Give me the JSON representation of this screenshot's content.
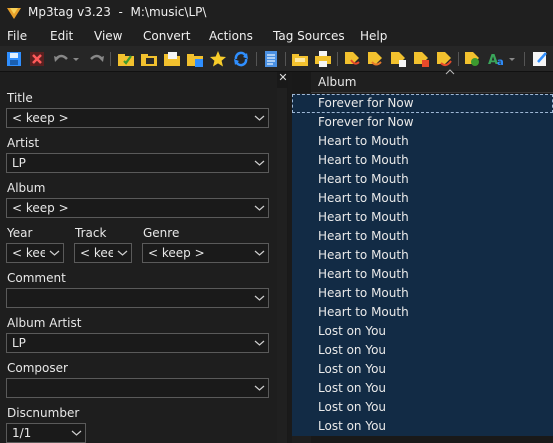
{
  "window": {
    "title": "Mp3tag v3.23  -  M:\\music\\LP\\"
  },
  "menu": [
    "File",
    "Edit",
    "View",
    "Convert",
    "Actions",
    "Tag Sources",
    "Help"
  ],
  "toolbar": {
    "buttons": [
      "save-icon",
      "remove-icon",
      "undo-icon",
      "redo-icon",
      "folder-check-icon",
      "folder-add-icon",
      "folder-open-icon",
      "folder-tag-icon",
      "star-icon",
      "refresh-icon",
      "text-file-icon",
      "folder-export-icon",
      "print-icon",
      "tag-convert-1-icon",
      "tag-convert-2-icon",
      "tag-convert-3-icon",
      "tag-convert-4-icon",
      "tag-convert-5-icon",
      "tag-sources-icon",
      "text-case-icon",
      "edit-note-icon"
    ],
    "accent_blue": "#2f8fff",
    "folder_yellow": "#f2c12e"
  },
  "panel": {
    "close_glyph": "✕"
  },
  "fields": {
    "title": {
      "label": "Title",
      "value": "< keep >"
    },
    "artist": {
      "label": "Artist",
      "value": "LP"
    },
    "album": {
      "label": "Album",
      "value": "< keep >"
    },
    "year": {
      "label": "Year",
      "value": "< keep >"
    },
    "track": {
      "label": "Track",
      "value": "< keep >"
    },
    "genre": {
      "label": "Genre",
      "value": "< keep >"
    },
    "comment": {
      "label": "Comment",
      "value": ""
    },
    "album_artist": {
      "label": "Album Artist",
      "value": "LP"
    },
    "composer": {
      "label": "Composer",
      "value": ""
    },
    "discnumber": {
      "label": "Discnumber",
      "value": "1/1"
    }
  },
  "grid": {
    "column": "Album",
    "selection_color": "#122b45",
    "rows": [
      "Forever for Now",
      "Forever for Now",
      "Heart to Mouth",
      "Heart to Mouth",
      "Heart to Mouth",
      "Heart to Mouth",
      "Heart to Mouth",
      "Heart to Mouth",
      "Heart to Mouth",
      "Heart to Mouth",
      "Heart to Mouth",
      "Heart to Mouth",
      "Lost on You",
      "Lost on You",
      "Lost on You",
      "Lost on You",
      "Lost on You",
      "Lost on You"
    ]
  }
}
